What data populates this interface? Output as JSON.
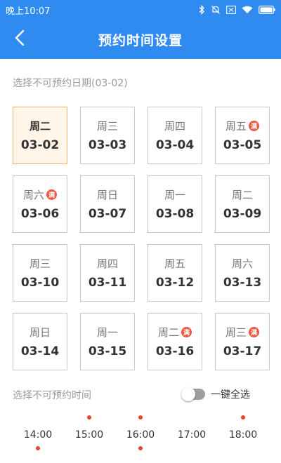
{
  "status_bar": {
    "time": "晚上10:07",
    "icons": [
      "bluetooth-icon",
      "mute-icon",
      "sim-card-icon",
      "wifi-icon",
      "battery-icon"
    ]
  },
  "app_bar": {
    "title": "预约时间设置",
    "back_icon": "chevron-left-icon"
  },
  "date_section": {
    "label": "选择不可预约日期(03-02)",
    "badge_text": "满",
    "dates": [
      {
        "weekday": "周二",
        "date": "03-02",
        "selected": true,
        "full": false
      },
      {
        "weekday": "周三",
        "date": "03-03",
        "selected": false,
        "full": false
      },
      {
        "weekday": "周四",
        "date": "03-04",
        "selected": false,
        "full": false
      },
      {
        "weekday": "周五",
        "date": "03-05",
        "selected": false,
        "full": true
      },
      {
        "weekday": "周六",
        "date": "03-06",
        "selected": false,
        "full": true
      },
      {
        "weekday": "周日",
        "date": "03-07",
        "selected": false,
        "full": false
      },
      {
        "weekday": "周一",
        "date": "03-08",
        "selected": false,
        "full": false
      },
      {
        "weekday": "周二",
        "date": "03-09",
        "selected": false,
        "full": false
      },
      {
        "weekday": "周三",
        "date": "03-10",
        "selected": false,
        "full": false
      },
      {
        "weekday": "周四",
        "date": "03-11",
        "selected": false,
        "full": false
      },
      {
        "weekday": "周五",
        "date": "03-12",
        "selected": false,
        "full": false
      },
      {
        "weekday": "周六",
        "date": "03-13",
        "selected": false,
        "full": false
      },
      {
        "weekday": "周日",
        "date": "03-14",
        "selected": false,
        "full": false
      },
      {
        "weekday": "周一",
        "date": "03-15",
        "selected": false,
        "full": false
      },
      {
        "weekday": "周二",
        "date": "03-16",
        "selected": false,
        "full": true
      },
      {
        "weekday": "周三",
        "date": "03-17",
        "selected": false,
        "full": true
      }
    ]
  },
  "time_section": {
    "label": "选择不可预约时间",
    "select_all_label": "一键全选",
    "select_all_on": false,
    "times": [
      {
        "time": "14:00",
        "dot_top": false,
        "dot_bottom": true
      },
      {
        "time": "15:00",
        "dot_top": true,
        "dot_bottom": false
      },
      {
        "time": "16:00",
        "dot_top": true,
        "dot_bottom": true
      },
      {
        "time": "17:00",
        "dot_top": false,
        "dot_bottom": false
      },
      {
        "time": "18:00",
        "dot_top": true,
        "dot_bottom": false
      }
    ]
  },
  "colors": {
    "primary": "#2f8bf0",
    "selected_bg": "#fff5e9",
    "selected_border": "#f0b074",
    "badge": "#e85a44",
    "dot": "#e8452f"
  }
}
